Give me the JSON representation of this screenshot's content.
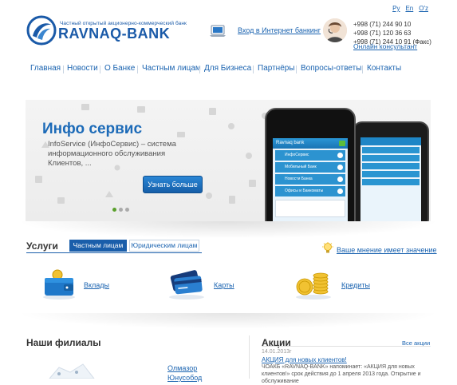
{
  "header": {
    "logo_small": "Частный открытый акционерно-коммерческий банк",
    "logo_name": "RAVNAQ-BANK",
    "internet_banking": "Вход в Интернет банкинг",
    "phones": [
      "+998 (71) 244 90 10",
      "+998 (71) 120 36 63",
      "+998 (71) 244 10 91 (Факс)"
    ],
    "online_consultant": "Онлайн консультант",
    "langs": [
      "Ру",
      "En",
      "O'z"
    ]
  },
  "nav": {
    "items": [
      "Главная",
      "Новости",
      "О Банке",
      "Частным лицам",
      "Для Бизнеса",
      "Партнёры",
      "Вопросы-ответы",
      "Контакты"
    ]
  },
  "banner": {
    "title": "Инфо сервис",
    "text": "InfoService (ИнфоСервис) – система информационного обслуживания Клиентов, ...",
    "button": "Узнать больше",
    "phone_header": "Ravnaq bank",
    "phone_menu": [
      "ИнфоСервис",
      "Мобильный Банк",
      "Новости Банка",
      "Офисы и Банкоматы"
    ],
    "slides_total": 3,
    "slide_active": 1
  },
  "services": {
    "title": "Услуги",
    "tab_active": "Частным лицам",
    "tab_other": "Юридическим лицам",
    "opinion": "Ваше мнение имеет значение",
    "items": [
      {
        "label": "Вклады",
        "icon": "wallet-icon"
      },
      {
        "label": "Карты",
        "icon": "cards-icon"
      },
      {
        "label": "Кредиты",
        "icon": "coins-icon"
      }
    ]
  },
  "branches": {
    "title": "Наши филиалы",
    "links": [
      "Олмазор",
      "Юнусобод"
    ]
  },
  "news": {
    "title": "Акции",
    "all": "Все акции",
    "date": "14.01.2013г",
    "headline": "АКЦИЯ для новых клиентов!",
    "text": "ЧОАКБ «RAVNAQ-BANK» напоминает: «АКЦИЯ для новых клиентов!» срок действия до 1 апреля 2013 года. Открытие и обслуживание"
  },
  "colors": {
    "brand": "#1a5aa8",
    "link": "#1a63b0",
    "button": "#1e6fbf"
  }
}
